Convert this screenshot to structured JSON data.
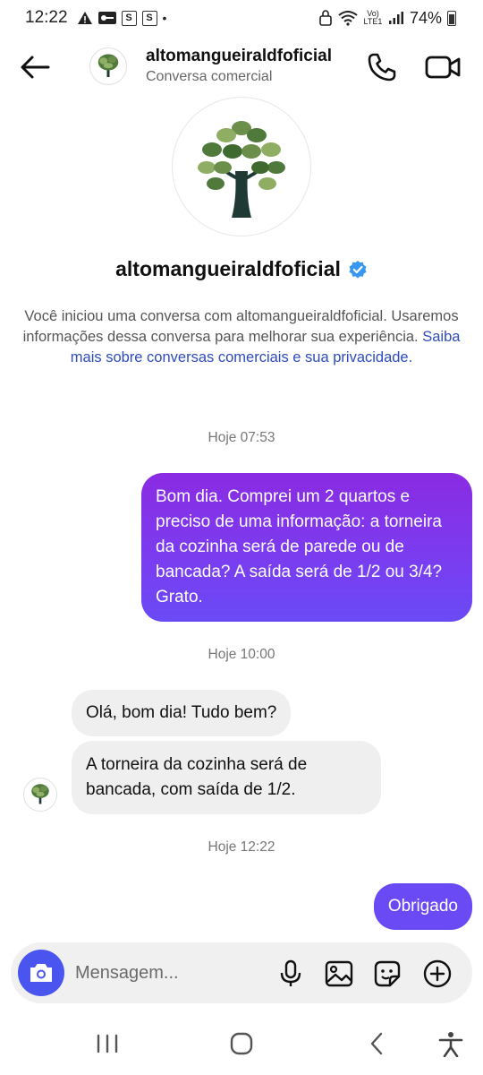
{
  "status_bar": {
    "time": "12:22",
    "badge1": "S",
    "badge2": "S",
    "dot": "•",
    "network_label": "Vo) LTE1",
    "battery": "74%"
  },
  "header": {
    "name": "altomangueiraldfoficial",
    "subtitle": "Conversa comercial"
  },
  "profile": {
    "name": "altomangueiraldfoficial",
    "verified": true
  },
  "intro": {
    "text": "Você iniciou uma conversa com altomangueiraldfoficial. Usaremos informações dessa conversa para melhorar sua experiência. ",
    "link": "Saiba mais sobre conversas comerciais e sua privacidade."
  },
  "messages": [
    {
      "timestamp": "Hoje 07:53"
    },
    {
      "text": "Bom dia. Comprei um 2 quartos e preciso de uma informação: a torneira da cozinha será de parede ou de bancada? A saída será de 1/2 ou 3/4? Grato.",
      "direction": "out"
    },
    {
      "timestamp": "Hoje 10:00"
    },
    {
      "text": "Olá, bom dia! Tudo bem?",
      "direction": "in"
    },
    {
      "text": "A torneira da cozinha será de bancada, com saída de 1/2.",
      "direction": "in"
    },
    {
      "timestamp": "Hoje 12:22"
    },
    {
      "text": "Obrigado",
      "direction": "out"
    }
  ],
  "composer": {
    "placeholder": "Mensagem..."
  },
  "colors": {
    "outgoing_start": "#8a2be2",
    "outgoing_end": "#6a4af5",
    "incoming": "#efefef",
    "accent": "#4a55f0",
    "link": "#2f4bbd",
    "verified": "#3897f0"
  },
  "icons": [
    "back-arrow-icon",
    "phone-icon",
    "video-camera-icon",
    "verified-badge-icon",
    "camera-icon",
    "microphone-icon",
    "image-icon",
    "sticker-icon",
    "plus-icon",
    "recents-icon",
    "home-icon",
    "nav-back-icon",
    "accessibility-icon"
  ]
}
